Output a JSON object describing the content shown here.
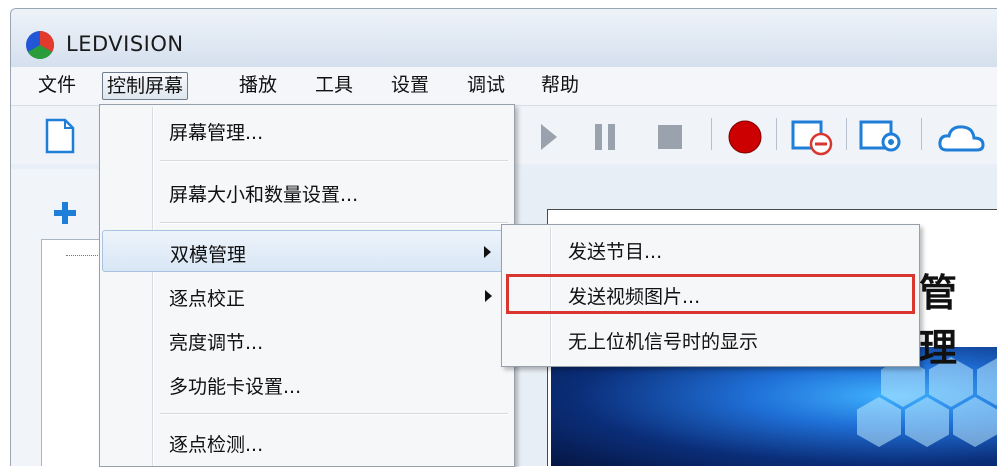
{
  "app": {
    "title": "LEDVISION",
    "icon": "led-rgb-logo-icon"
  },
  "menubar": {
    "items": [
      "文件",
      "控制屏幕",
      "播放",
      "工具",
      "设置",
      "调试",
      "帮助"
    ],
    "active_index": 1
  },
  "toolbar": {
    "icons": [
      "new-file-icon",
      "play-icon",
      "pause-icon",
      "stop-icon",
      "record-icon",
      "screen-off-icon",
      "screen-settings-icon",
      "cloud-icon"
    ]
  },
  "dropdown": {
    "items": [
      {
        "label": "屏幕管理...",
        "has_submenu": false
      },
      {
        "label": "屏幕大小和数量设置...",
        "has_submenu": false
      },
      {
        "label": "双模管理",
        "has_submenu": true,
        "hover": true
      },
      {
        "label": "逐点校正",
        "has_submenu": true
      },
      {
        "label": "亮度调节...",
        "has_submenu": false
      },
      {
        "label": "多功能卡设置...",
        "has_submenu": false
      },
      {
        "label": "逐点检测...",
        "has_submenu": false
      }
    ]
  },
  "submenu": {
    "items": [
      {
        "label": "发送节目..."
      },
      {
        "label": "发送视频图片...",
        "highlighted": true
      },
      {
        "label": "无上位机信号时的显示"
      }
    ]
  },
  "preview": {
    "title_fragment": "管理"
  },
  "colors": {
    "highlight_border": "#d9362f",
    "play_disabled": "#9aa3ad",
    "record": "#cc0000",
    "toolbar_blue": "#1f7fd8"
  }
}
